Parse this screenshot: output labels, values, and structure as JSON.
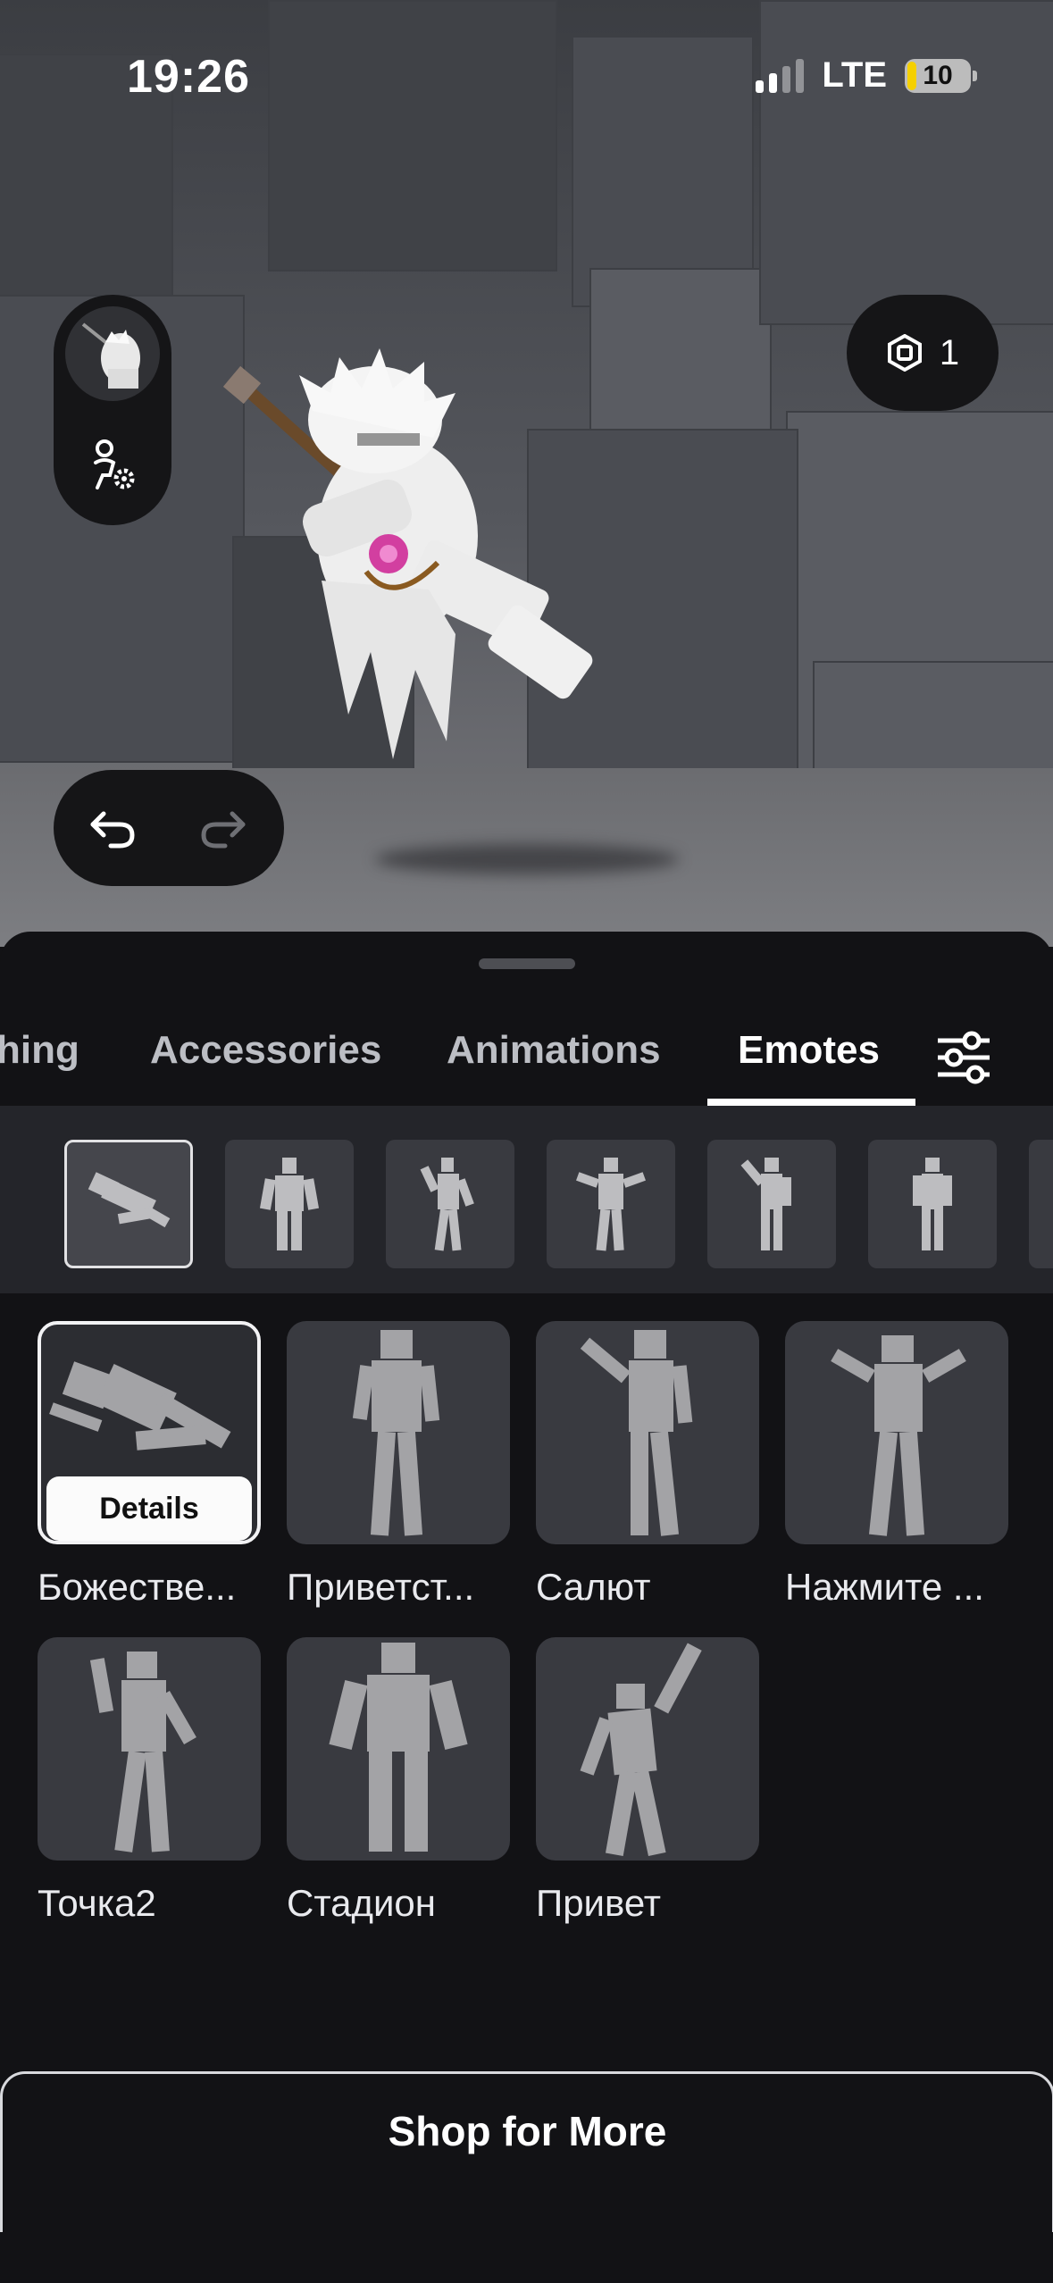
{
  "status_bar": {
    "time": "19:26",
    "network": "LTE",
    "battery": "10",
    "signal_bars_active": 2,
    "signal_bars_total": 4
  },
  "robux": {
    "balance": "1",
    "icon": "robux-icon"
  },
  "tabs": [
    {
      "label": "hing",
      "active": false
    },
    {
      "label": "Accessories",
      "active": false
    },
    {
      "label": "Animations",
      "active": false
    },
    {
      "label": "Emotes",
      "active": true
    }
  ],
  "subcategories": [
    {
      "icon": "emote-pose-lying-icon",
      "selected": true
    },
    {
      "icon": "emote-pose-stadium-icon",
      "selected": false
    },
    {
      "icon": "emote-pose-point-icon",
      "selected": false
    },
    {
      "icon": "emote-pose-shrug-icon",
      "selected": false
    },
    {
      "icon": "emote-pose-salute-icon",
      "selected": false
    },
    {
      "icon": "emote-pose-stand-icon",
      "selected": false
    }
  ],
  "emotes": [
    {
      "label": "Божестве...",
      "selected": true
    },
    {
      "label": "Приветст...",
      "selected": false
    },
    {
      "label": "Салют",
      "selected": false
    },
    {
      "label": "Нажмите ...",
      "selected": false
    },
    {
      "label": "Точка2",
      "selected": false
    },
    {
      "label": "Стадион",
      "selected": false
    },
    {
      "label": "Привет",
      "selected": false
    }
  ],
  "details_label": "Details",
  "shop_label": "Shop for More",
  "colors": {
    "accent_battery": "#f5d000",
    "sheet_bg": "#121215",
    "tile_bg": "#393a40",
    "figure_gray": "#a3a3a6"
  }
}
